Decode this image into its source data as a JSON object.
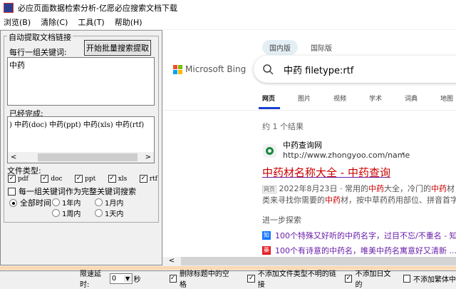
{
  "window": {
    "title": "必应页面数据检索分析-亿愿必应搜索文档下载"
  },
  "menu": [
    "浏览(B)",
    "清除(C)",
    "工具(T)",
    "帮助(H)"
  ],
  "panel": {
    "group_title": "自动提取文档链接",
    "keywords_label": "每行一组关键词:",
    "start_button": "开始批量搜索提取",
    "keywords_value": "中药",
    "done_label": "已经完成:",
    "done_value": ") 中药(doc) 中药(ppt) 中药(xls) 中药(rtf)",
    "scroll_left": "<",
    "scroll_right": ">",
    "filetype_label": "文件类型:",
    "filetypes": [
      {
        "label": "pdf",
        "checked": true
      },
      {
        "label": "doc",
        "checked": true
      },
      {
        "label": "ppt",
        "checked": true
      },
      {
        "label": "xls",
        "checked": true
      },
      {
        "label": "rtf",
        "checked": true
      }
    ],
    "whole_keyword": "每一组关键词作为完整关键词搜索",
    "time_options": [
      "全部时间",
      "1年内",
      "1月内",
      "1周内",
      "1天内"
    ]
  },
  "browser": {
    "tabs": [
      "国内版",
      "国际版"
    ],
    "logo": "Microsoft Bing",
    "query": "中药 filetype:rtf",
    "nav": [
      "网页",
      "图片",
      "视频",
      "学术",
      "词典",
      "地图"
    ],
    "count": "约 1 个结果",
    "result": {
      "site": "中药查询网",
      "url": "http://www.zhongyoo.com/name",
      "title": "中药材名称大全 - 中药查询",
      "badge": "网页",
      "date": "2022年8月23日",
      "s1a": " · 常用的",
      "s1b": "中药",
      "s1c": "大全，冷门的",
      "s1d": "中药",
      "s1e": "材",
      "s2a": "类来寻找你需要的",
      "s2b": "中药",
      "s2c": "材，按中草药药用部位、拼音首字"
    },
    "explore_label": "进一步探索",
    "related": [
      {
        "icon": "知",
        "text": "100个特殊又好听的中药名字，过目不忘/不重名 - 知"
      },
      {
        "icon": "藥",
        "text": "100个有诗意的中药名，唯美中药名寓意好又清新 ..."
      }
    ],
    "scroll_left": "<"
  },
  "status": {
    "delay_label": "限速延时:",
    "delay_value": "0",
    "delay_unit": "秒",
    "opt1": "删除标题中的空格",
    "opt2": "不添加文件类型不明的链接",
    "opt3": "不添加日文的",
    "opt4": "不添加繁体中"
  },
  "colors": {
    "link": "#681da8",
    "highlight": "#c00",
    "nav_active": "#1a3fcf"
  }
}
